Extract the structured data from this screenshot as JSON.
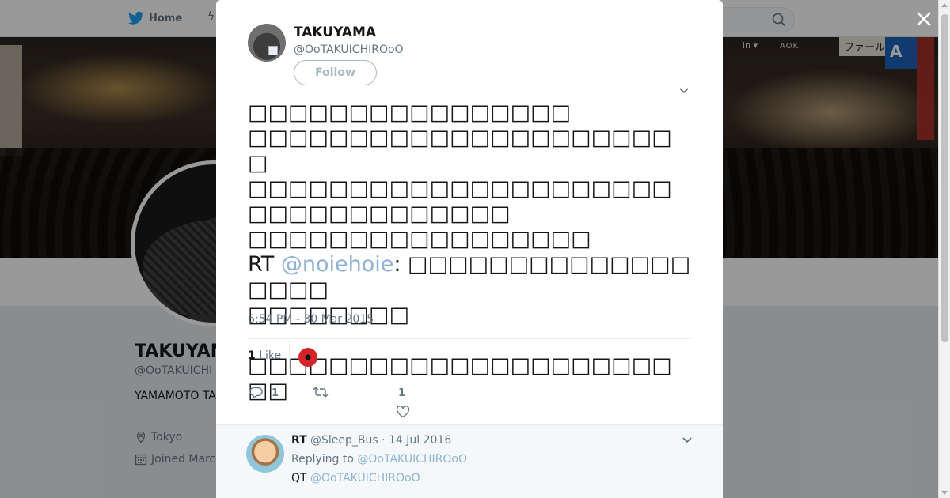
{
  "nav": {
    "home_label": "Home"
  },
  "banner_signs": {
    "in": "in ▾",
    "ao": "AOK",
    "jp": "ファール",
    "a": "A"
  },
  "background_profile": {
    "name": "TAKUYAM",
    "handle": "@OoTAKUICHI",
    "bio": "YAMAMOTO TA",
    "location": "Tokyo",
    "joined": "Joined Marc"
  },
  "tweet": {
    "author_name": "TAKUYAMA",
    "author_handle": "@OoTAKUICHIROoO",
    "follow_label": "Follow",
    "text_lines": [
      "□□□□□□□□□□□□□□□□",
      "□□□□□□□□□□□□□□□□□□□□□□",
      "□□□□□□□□□□□□□□□□□□□□□□□□□□□□□□□□□□",
      "□□□□□□□□□□□□□□□□□"
    ],
    "rt_prefix": "RT ",
    "rt_mention": "@noiehoie",
    "rt_after": ": □□□□□□□□□□□□□□□□□□",
    "rt_line2": "□□□□□□□□",
    "text_last": "□□□□□□□□□□□□□□□□□□□□□□□",
    "timestamp": "6:54 PM - 30 Mar 2015",
    "likes_count": "1",
    "likes_label": "Like",
    "reply_count": "1",
    "like_count": "1"
  },
  "reply": {
    "name": "RT",
    "handle_date": "@Sleep_Bus · 14 Jul 2016",
    "replying_prefix": "Replying to ",
    "replying_to": "@OoTAKUICHIROoO",
    "body_prefix": "QT ",
    "body_mention": "@OoTAKUICHIROoO"
  },
  "colors": {
    "accent": "#1da1f2",
    "link_muted": "#8fb3d3",
    "text_secondary": "#657786"
  }
}
